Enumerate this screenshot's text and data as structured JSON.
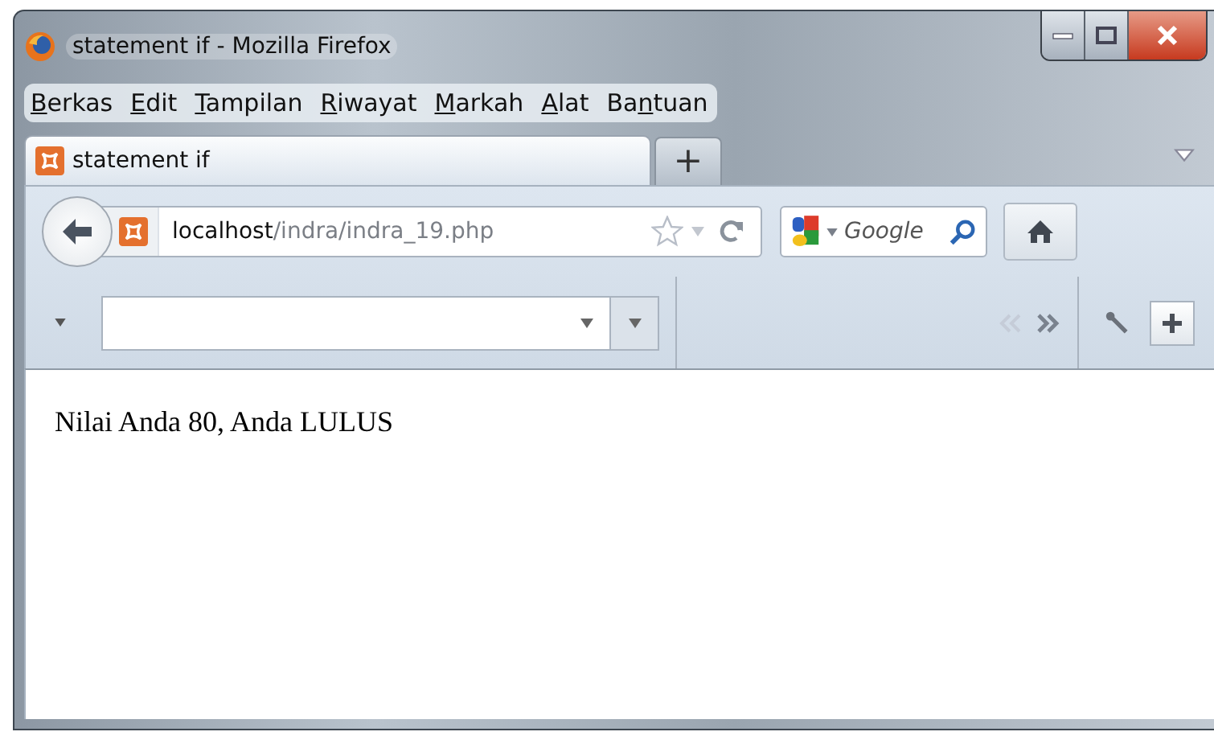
{
  "window": {
    "title": "statement if - Mozilla Firefox"
  },
  "menu": [
    {
      "accel": "B",
      "after": "erkas"
    },
    {
      "accel": "E",
      "after": "dit"
    },
    {
      "accel": "T",
      "after": "ampilan"
    },
    {
      "accel": "R",
      "after": "iwayat"
    },
    {
      "accel": "M",
      "after": "arkah"
    },
    {
      "accel": "A",
      "after": "lat"
    },
    {
      "before": "Ba",
      "accel": "n",
      "after": "tuan"
    }
  ],
  "tabs": [
    {
      "label": "statement if",
      "selected": true
    }
  ],
  "new_tab": "+",
  "address": {
    "host": "localhost",
    "path": "/indra/indra_19.php"
  },
  "search": {
    "placeholder": "Google"
  },
  "page": {
    "text": "Nilai Anda 80, Anda LULUS"
  }
}
